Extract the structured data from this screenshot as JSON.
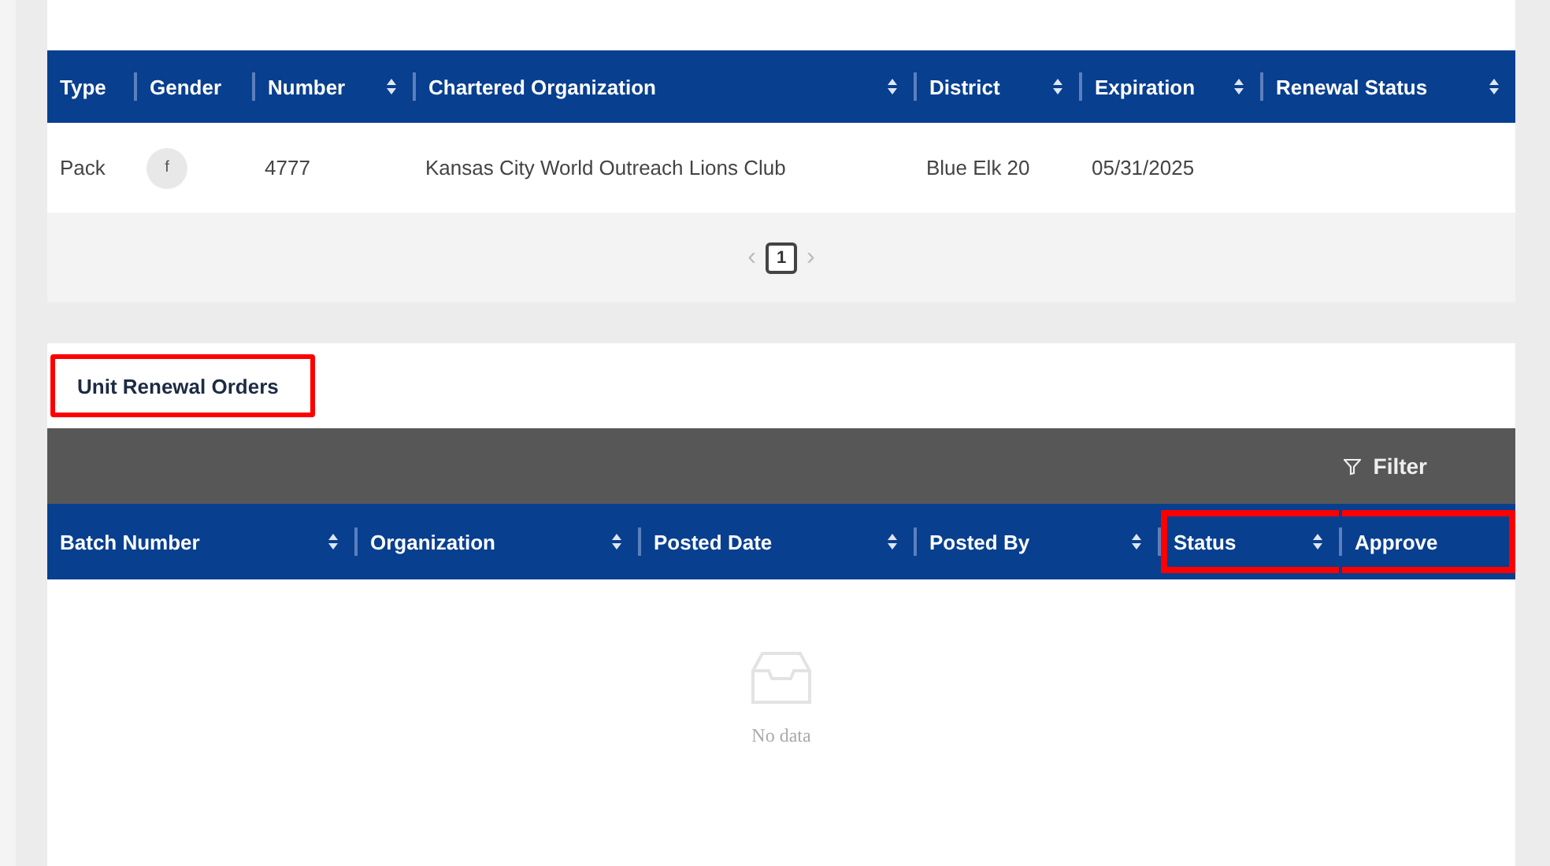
{
  "units_table": {
    "columns": [
      {
        "label": "Type",
        "sortable": false
      },
      {
        "label": "Gender",
        "sortable": false
      },
      {
        "label": "Number",
        "sortable": true
      },
      {
        "label": "Chartered Organization",
        "sortable": true
      },
      {
        "label": "District",
        "sortable": true
      },
      {
        "label": "Expiration",
        "sortable": true
      },
      {
        "label": "Renewal Status",
        "sortable": true
      }
    ],
    "rows": [
      {
        "type": "Pack",
        "gender": "f",
        "number": "4777",
        "chartered_organization": "Kansas City World Outreach Lions Club",
        "district": "Blue Elk 20",
        "expiration": "05/31/2025"
      }
    ],
    "pagination": {
      "previous": "‹",
      "pages": [
        {
          "label": "1",
          "selected": true
        }
      ],
      "next": "›"
    }
  },
  "renewal_orders": {
    "title": "Unit Renewal Orders",
    "title_highlighted": true,
    "filter": "Filter",
    "columns": [
      {
        "label": "Batch Number",
        "sortable": true,
        "highlighted": false
      },
      {
        "label": "Organization",
        "sortable": true,
        "highlighted": false
      },
      {
        "label": "Posted Date",
        "sortable": true,
        "highlighted": false
      },
      {
        "label": "Posted By",
        "sortable": true,
        "highlighted": false
      },
      {
        "label": "Status",
        "sortable": true,
        "highlighted": true
      },
      {
        "label": "Approve",
        "sortable": false,
        "highlighted": true
      }
    ],
    "empty_text": "No data"
  }
}
